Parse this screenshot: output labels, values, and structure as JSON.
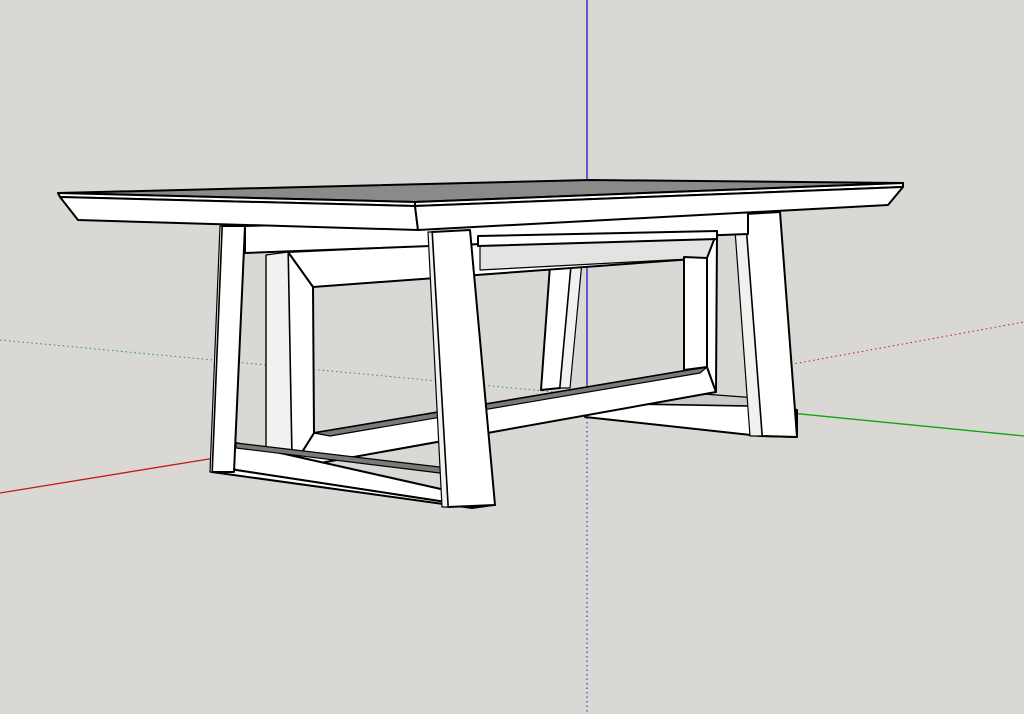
{
  "app": {
    "name": "",
    "view": "perspective"
  },
  "scene": {
    "model": "trestle table",
    "background_color": "#d9d8d5",
    "edge_color": "#000000",
    "face_color": "#ffffff"
  },
  "axes": {
    "red": {
      "color": "#c00000",
      "style": "solid/dotted"
    },
    "green": {
      "color": "#00a000",
      "style": "solid/dotted"
    },
    "blue": {
      "color": "#0000cc",
      "style": "solid/dotted"
    }
  }
}
